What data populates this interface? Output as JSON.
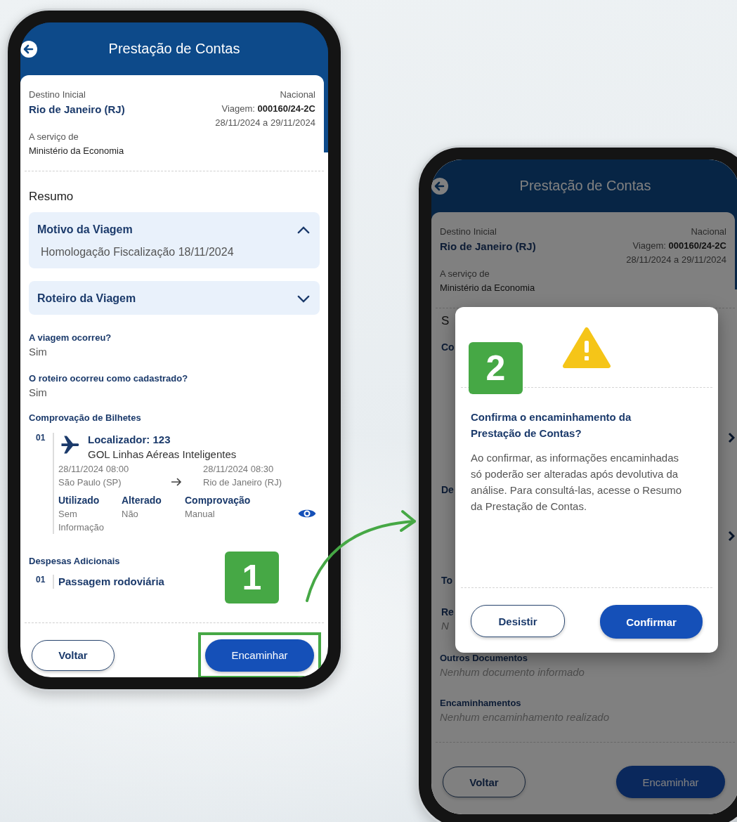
{
  "phones": [
    {
      "kind": "details",
      "step_badge": "1",
      "header": {
        "title": "Prestação de Contas"
      },
      "trip": {
        "destination_label": "Destino Inicial",
        "destination": "Rio de Janeiro (RJ)",
        "scope": "Nacional",
        "trip_label": "Viagem:",
        "trip_number": "000160/24-2C",
        "dates": "28/11/2024 a 29/11/2024",
        "service_label": "A serviço de",
        "service": "Ministério da Economia"
      },
      "summary_title": "Resumo",
      "accordions": [
        {
          "title": "Motivo da Viagem",
          "expanded": true,
          "body": "Homologação Fiscalização 18/11/2024"
        },
        {
          "title": "Roteiro da Viagem",
          "expanded": false
        }
      ],
      "questions": [
        {
          "question": "A viagem ocorreu?",
          "answer": "Sim"
        },
        {
          "question": "O roteiro ocorreu como cadastrado?",
          "answer": "Sim"
        }
      ],
      "tickets": {
        "title": "Comprovação de Bilhetes",
        "items": [
          {
            "index": "01",
            "locator": "Localizador: 123",
            "airline": "GOL Linhas Aéreas Inteligentes",
            "departure_time": "28/11/2024  08:00",
            "departure_place": "São Paulo (SP)",
            "arrival_time": "28/11/2024  08:30",
            "arrival_place": "Rio de Janeiro (RJ)",
            "fields": [
              {
                "label": "Utilizado",
                "value": "Sem Informação"
              },
              {
                "label": "Alterado",
                "value": "Não"
              },
              {
                "label": "Comprovação",
                "value": "Manual"
              }
            ]
          }
        ]
      },
      "expenses": {
        "title": "Despesas Adicionais",
        "items": [
          {
            "index": "01",
            "name": "Passagem rodoviária"
          }
        ]
      },
      "back_button": {
        "label": "Voltar"
      },
      "forward_button": {
        "label": "Encaminhar",
        "highlighted": true
      }
    },
    {
      "kind": "dialog",
      "step_badge": "2",
      "header": {
        "title": "Prestação de Contas"
      },
      "trip": {
        "destination_label": "Destino Inicial",
        "destination": "Rio de Janeiro (RJ)",
        "scope": "Nacional",
        "trip_label": "Viagem:",
        "trip_number": "000160/24-2C",
        "dates": "28/11/2024 a 29/11/2024",
        "service_label": "A serviço de",
        "service": "Ministério da Economia"
      },
      "fragments": [
        {
          "kind": "heading",
          "text": "S"
        },
        {
          "kind": "label",
          "text": "Co"
        },
        {
          "kind": "label",
          "text": "De"
        },
        {
          "kind": "label",
          "text": "To"
        },
        {
          "kind": "label",
          "text": "Re"
        },
        {
          "kind": "value",
          "text": "N"
        }
      ],
      "sections": [
        {
          "title": "Outros Documentos",
          "value": "Nenhum documento informado"
        },
        {
          "title": "Encaminhamentos",
          "value": "Nenhum encaminhamento realizado"
        }
      ],
      "dialog": {
        "title": "Confirma o encaminhamento da Prestação de Contas?",
        "message": "Ao confirmar, as informações encaminhadas só poderão ser alteradas após devolutiva da análise. Para consultá-las, acesse o Resumo da Prestação de Contas.",
        "cancel": "Desistir",
        "confirm": "Confirmar"
      },
      "back_button": {
        "label": "Voltar"
      },
      "forward_button": {
        "label": "Encaminhar",
        "highlighted": false
      }
    }
  ]
}
